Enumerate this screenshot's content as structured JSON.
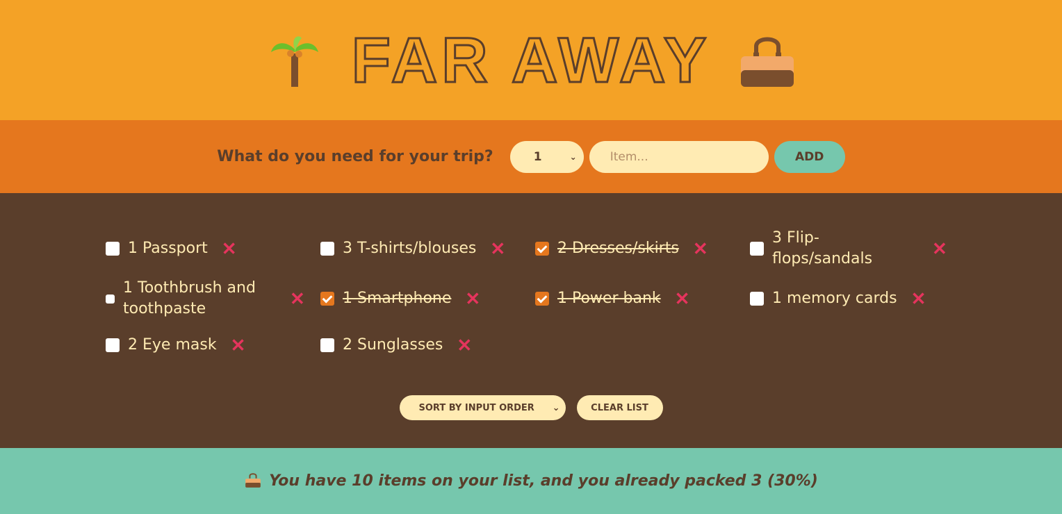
{
  "header": {
    "title": "FAR AWAY",
    "left_icon": "palm-tree-icon",
    "right_icon": "handbag-icon"
  },
  "form": {
    "label": "What do you need for your trip?",
    "quantity_value": "1",
    "item_placeholder": "Item...",
    "add_label": "ADD"
  },
  "items": [
    {
      "text": "1 Passport",
      "packed": false
    },
    {
      "text": "3 T-shirts/blouses",
      "packed": false
    },
    {
      "text": "2 Dresses/skirts",
      "packed": true
    },
    {
      "text": "3 Flip-flops/sandals",
      "packed": false
    },
    {
      "text": "1 Toothbrush and toothpaste",
      "packed": false
    },
    {
      "text": "1 Smartphone",
      "packed": true
    },
    {
      "text": "1 Power bank",
      "packed": true
    },
    {
      "text": "1 memory cards",
      "packed": false
    },
    {
      "text": "2 Eye mask",
      "packed": false
    },
    {
      "text": "2 Sunglasses",
      "packed": false
    }
  ],
  "actions": {
    "sort_value": "SORT BY INPUT ORDER",
    "clear_label": "CLEAR LIST"
  },
  "stats": {
    "icon": "handbag-icon",
    "text": "You have 10 items on your list, and you already packed 3 (30%)"
  },
  "colors": {
    "header_bg": "#f4a226",
    "form_bg": "#e5771e",
    "list_bg": "#5a3e2b",
    "stats_bg": "#76c7ad",
    "cream": "#ffebb3",
    "delete_red": "#e5345d"
  }
}
